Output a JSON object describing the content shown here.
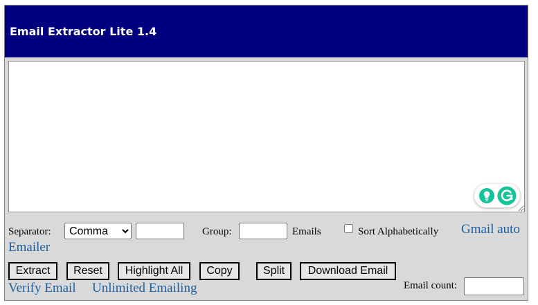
{
  "app": {
    "title": "Email Extractor Lite 1.4"
  },
  "input": {
    "text": ""
  },
  "options": {
    "separator_label": "Separator:",
    "separator_selected": "Comma",
    "separator_options": [
      "Comma"
    ],
    "separator_custom": "",
    "group_label": "Group:",
    "group_value": "",
    "emails_label": "Emails",
    "sort_label": "Sort Alphabetically",
    "sort_checked": false
  },
  "links": {
    "gmail_auto": "Gmail auto",
    "emailer": "Emailer",
    "verify_email": "Verify Email",
    "unlimited_emailing": "Unlimited Emailing"
  },
  "buttons": {
    "extract": "Extract",
    "reset": "Reset",
    "highlight_all": "Highlight All",
    "copy": "Copy",
    "split": "Split",
    "download_email": "Download Email"
  },
  "count": {
    "label": "Email count:",
    "value": ""
  },
  "colors": {
    "title_bg": "#000080",
    "panel_bg": "#d9d9d9",
    "link": "#1f5fa0",
    "grammarly": "#15c39a"
  },
  "icons": {
    "grammarly_suggestion": "lightbulb-icon",
    "grammarly_logo": "grammarly-icon"
  }
}
